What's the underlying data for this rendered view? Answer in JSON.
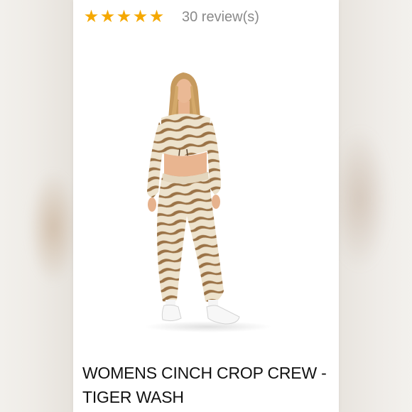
{
  "rating": {
    "stars": 5,
    "max_stars": 5,
    "star_glyph": "★",
    "star_color": "#f5a800",
    "reviews_label": "30 review(s)"
  },
  "product": {
    "image_icon": "product-photo",
    "title": "WOMENS CINCH CROP CREW - TIGER WASH"
  },
  "colors": {
    "background": "#ece8e2",
    "card": "#ffffff",
    "tiger_brown": "#9b7347",
    "tiger_cream": "#ede2cc",
    "title_text": "#111111",
    "reviews_text": "#8a8a8a"
  }
}
